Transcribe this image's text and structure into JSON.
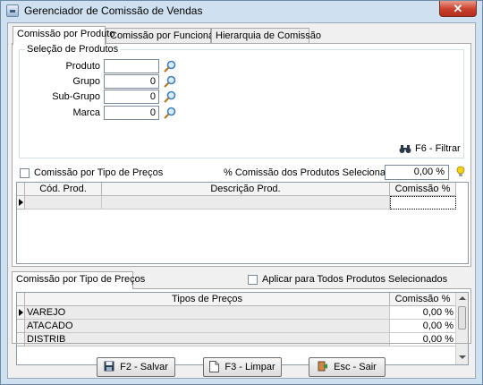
{
  "window": {
    "title": "Gerenciador de Comissão de Vendas",
    "close_glyph": "✕"
  },
  "tabs": [
    {
      "label": "Comissão por Produto"
    },
    {
      "label": "Comissão por Funcionário"
    },
    {
      "label": "Hierarquia de Comissão"
    }
  ],
  "selection": {
    "legend": "Seleção de Produtos",
    "fields": [
      {
        "label": "Produto",
        "value": ""
      },
      {
        "label": "Grupo",
        "value": "0"
      },
      {
        "label": "Sub-Grupo",
        "value": "0"
      },
      {
        "label": "Marca",
        "value": "0"
      }
    ],
    "filter_label": "F6 - Filtrar"
  },
  "price_type_check": {
    "label": "Comissão por Tipo de Preços",
    "checked": false
  },
  "selected_pct": {
    "label": "% Comissão dos Produtos Selecionados:",
    "value": "0,00 %"
  },
  "products_grid": {
    "columns": [
      "Cód. Prod.",
      "Descrição Prod.",
      "Comissão %"
    ],
    "rows": [
      {
        "code": "",
        "description": "",
        "pct": ""
      }
    ]
  },
  "price_section": {
    "tab_label": "Comissão por Tipo de Preços",
    "apply_all": {
      "label": "Aplicar para Todos Produtos Selecionados",
      "checked": false
    }
  },
  "price_grid": {
    "columns": [
      "Tipos de Preços",
      "Comissão %"
    ],
    "rows": [
      {
        "type": "VAREJO",
        "pct": "0,00 %"
      },
      {
        "type": "ATACADO",
        "pct": "0,00 %"
      },
      {
        "type": "DISTRIB",
        "pct": "0,00 %"
      }
    ]
  },
  "buttons": {
    "save": "F2 - Salvar",
    "clear": "F3 - Limpar",
    "exit": "Esc - Sair"
  },
  "colors": {
    "title_bg": "#cfe0f1",
    "close_red": "#c7402b",
    "selected_row": "#ebebeb",
    "bulb": "#f2d21a"
  }
}
